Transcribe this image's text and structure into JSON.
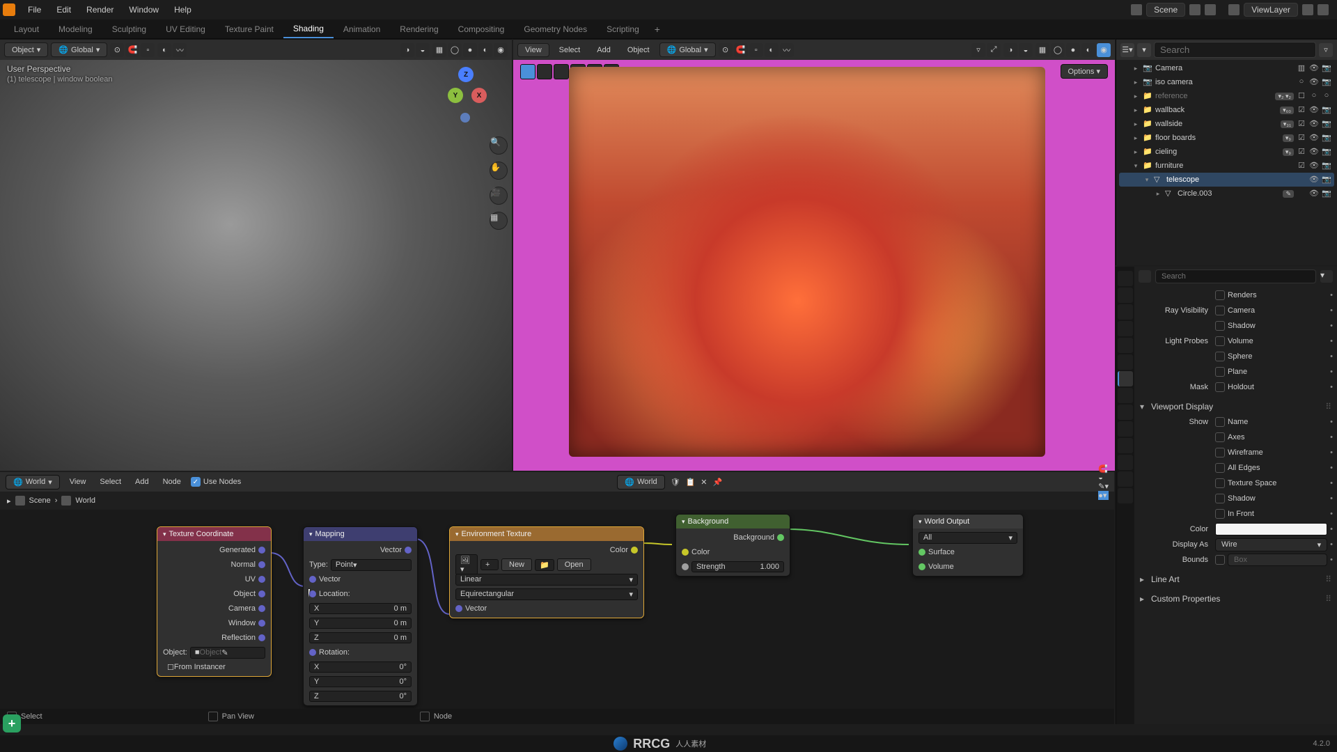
{
  "topbar": {
    "menus": [
      "File",
      "Edit",
      "Render",
      "Window",
      "Help"
    ],
    "scene_label": "Scene",
    "viewlayer_label": "ViewLayer"
  },
  "workspaces": {
    "tabs": [
      "Layout",
      "Modeling",
      "Sculpting",
      "UV Editing",
      "Texture Paint",
      "Shading",
      "Animation",
      "Rendering",
      "Compositing",
      "Geometry Nodes",
      "Scripting"
    ],
    "active": "Shading"
  },
  "vp_left": {
    "hdr": {
      "mode": "Object",
      "orient": "Global"
    },
    "overlay": {
      "persp": "User Perspective",
      "obj": "(1) telescope | window boolean"
    },
    "axes": {
      "x": "X",
      "y": "Y",
      "z": "Z"
    }
  },
  "vp_right": {
    "hdr": {
      "menus": [
        "View",
        "Select",
        "Add",
        "Object"
      ],
      "orient": "Global",
      "options": "Options"
    }
  },
  "outliner": {
    "search_ph": "Search",
    "rows": [
      {
        "ind": 1,
        "exp": "▸",
        "icon": "camera-icon",
        "label": "Camera",
        "sel": false,
        "badge": "",
        "tgls": [
          "▥",
          "👁",
          "📷"
        ]
      },
      {
        "ind": 1,
        "exp": "▸",
        "icon": "camera-icon",
        "label": "iso camera",
        "sel": false,
        "badge": "",
        "tgls": [
          "○",
          "👁",
          "📷"
        ]
      },
      {
        "ind": 1,
        "exp": "▸",
        "icon": "collection-icon",
        "label": "reference",
        "dim": true,
        "badge": "▾₂ ▾₂",
        "tgls": [
          "☐",
          "○",
          "○"
        ]
      },
      {
        "ind": 1,
        "exp": "▸",
        "icon": "collection-icon",
        "label": "wallback",
        "badge": "▾₆₀",
        "tgls": [
          "☑",
          "👁",
          "📷"
        ]
      },
      {
        "ind": 1,
        "exp": "▸",
        "icon": "collection-icon",
        "label": "wallside",
        "badge": "▾₃₁",
        "tgls": [
          "☑",
          "👁",
          "📷"
        ]
      },
      {
        "ind": 1,
        "exp": "▸",
        "icon": "collection-icon",
        "label": "floor boards",
        "badge": "▾₉",
        "tgls": [
          "☑",
          "👁",
          "📷"
        ]
      },
      {
        "ind": 1,
        "exp": "▸",
        "icon": "collection-icon",
        "label": "cieling",
        "badge": "▾₉",
        "tgls": [
          "☑",
          "👁",
          "📷"
        ]
      },
      {
        "ind": 1,
        "exp": "▾",
        "icon": "collection-icon",
        "label": "furniture",
        "tgls": [
          "☑",
          "👁",
          "📷"
        ]
      },
      {
        "ind": 2,
        "exp": "▾",
        "icon": "mesh-icon",
        "label": "telescope",
        "sel": true,
        "tgls": [
          "",
          "👁",
          "📷"
        ]
      },
      {
        "ind": 3,
        "exp": "▸",
        "icon": "mesh-icon",
        "label": "Circle.003",
        "badge": "✎",
        "tgls": [
          "",
          "👁",
          "📷"
        ]
      }
    ]
  },
  "props": {
    "search_ph": "Search",
    "rows_top": [
      {
        "label": "",
        "field": "Renders",
        "dot": true
      },
      {
        "label": "Ray Visibility",
        "field": "Camera",
        "dot": true
      },
      {
        "label": "",
        "field": "Shadow",
        "dot": true
      },
      {
        "label": "Light Probes",
        "field": "Volume",
        "dot": true
      },
      {
        "label": "",
        "field": "Sphere",
        "dot": true
      },
      {
        "label": "",
        "field": "Plane",
        "dot": true
      },
      {
        "label": "Mask",
        "field": "Holdout",
        "dot": true
      }
    ],
    "section_vd": "Viewport Display",
    "rows_vd": [
      {
        "label": "Show",
        "field": "Name",
        "type": "chk"
      },
      {
        "label": "",
        "field": "Axes",
        "type": "chk"
      },
      {
        "label": "",
        "field": "Wireframe",
        "type": "chk"
      },
      {
        "label": "",
        "field": "All Edges",
        "type": "chk"
      },
      {
        "label": "",
        "field": "Texture Space",
        "type": "chk"
      },
      {
        "label": "",
        "field": "Shadow",
        "type": "chk"
      },
      {
        "label": "",
        "field": "In Front",
        "type": "chk"
      },
      {
        "label": "Color",
        "field": "",
        "type": "color"
      },
      {
        "label": "Display As",
        "field": "Wire",
        "type": "sel"
      },
      {
        "label": "Bounds",
        "field": "Box",
        "type": "chksel"
      }
    ],
    "section_la": "Line Art",
    "section_cp": "Custom Properties"
  },
  "nodeeditor": {
    "hdr": {
      "type": "World",
      "menus": [
        "View",
        "Select",
        "Add",
        "Node"
      ],
      "use_nodes": "Use Nodes",
      "slot": "World"
    },
    "breadcrumb": [
      "Scene",
      "World"
    ],
    "nodes": {
      "texcoord": {
        "title": "Texture Coordinate",
        "outputs": [
          "Generated",
          "Normal",
          "UV",
          "Object",
          "Camera",
          "Window",
          "Reflection"
        ],
        "obj_label": "Object:",
        "obj_field": "Object",
        "from_inst": "From Instancer"
      },
      "mapping": {
        "title": "Mapping",
        "out": "Vector",
        "type_label": "Type:",
        "type_val": "Point",
        "in_vector": "Vector",
        "loc": "Location:",
        "rot": "Rotation:",
        "loc_rows": [
          {
            "a": "X",
            "v": "0 m"
          },
          {
            "a": "Y",
            "v": "0 m"
          },
          {
            "a": "Z",
            "v": "0 m"
          }
        ],
        "rot_rows": [
          {
            "a": "X",
            "v": "0°"
          },
          {
            "a": "Y",
            "v": "0°"
          },
          {
            "a": "Z",
            "v": "0°"
          }
        ]
      },
      "envtex": {
        "title": "Environment Texture",
        "out": "Color",
        "new": "New",
        "open": "Open",
        "interp": "Linear",
        "proj": "Equirectangular",
        "in_vector": "Vector"
      },
      "background": {
        "title": "Background",
        "out": "Background",
        "in_color": "Color",
        "strength_label": "Strength",
        "strength_val": "1.000"
      },
      "worldout": {
        "title": "World Output",
        "target": "All",
        "in_surface": "Surface",
        "in_volume": "Volume"
      }
    },
    "status": {
      "select": "Select",
      "pan": "Pan View",
      "node": "Node"
    }
  },
  "footer": {
    "brand": "RRCG",
    "sub": "人人素材",
    "version": "4.2.0"
  }
}
